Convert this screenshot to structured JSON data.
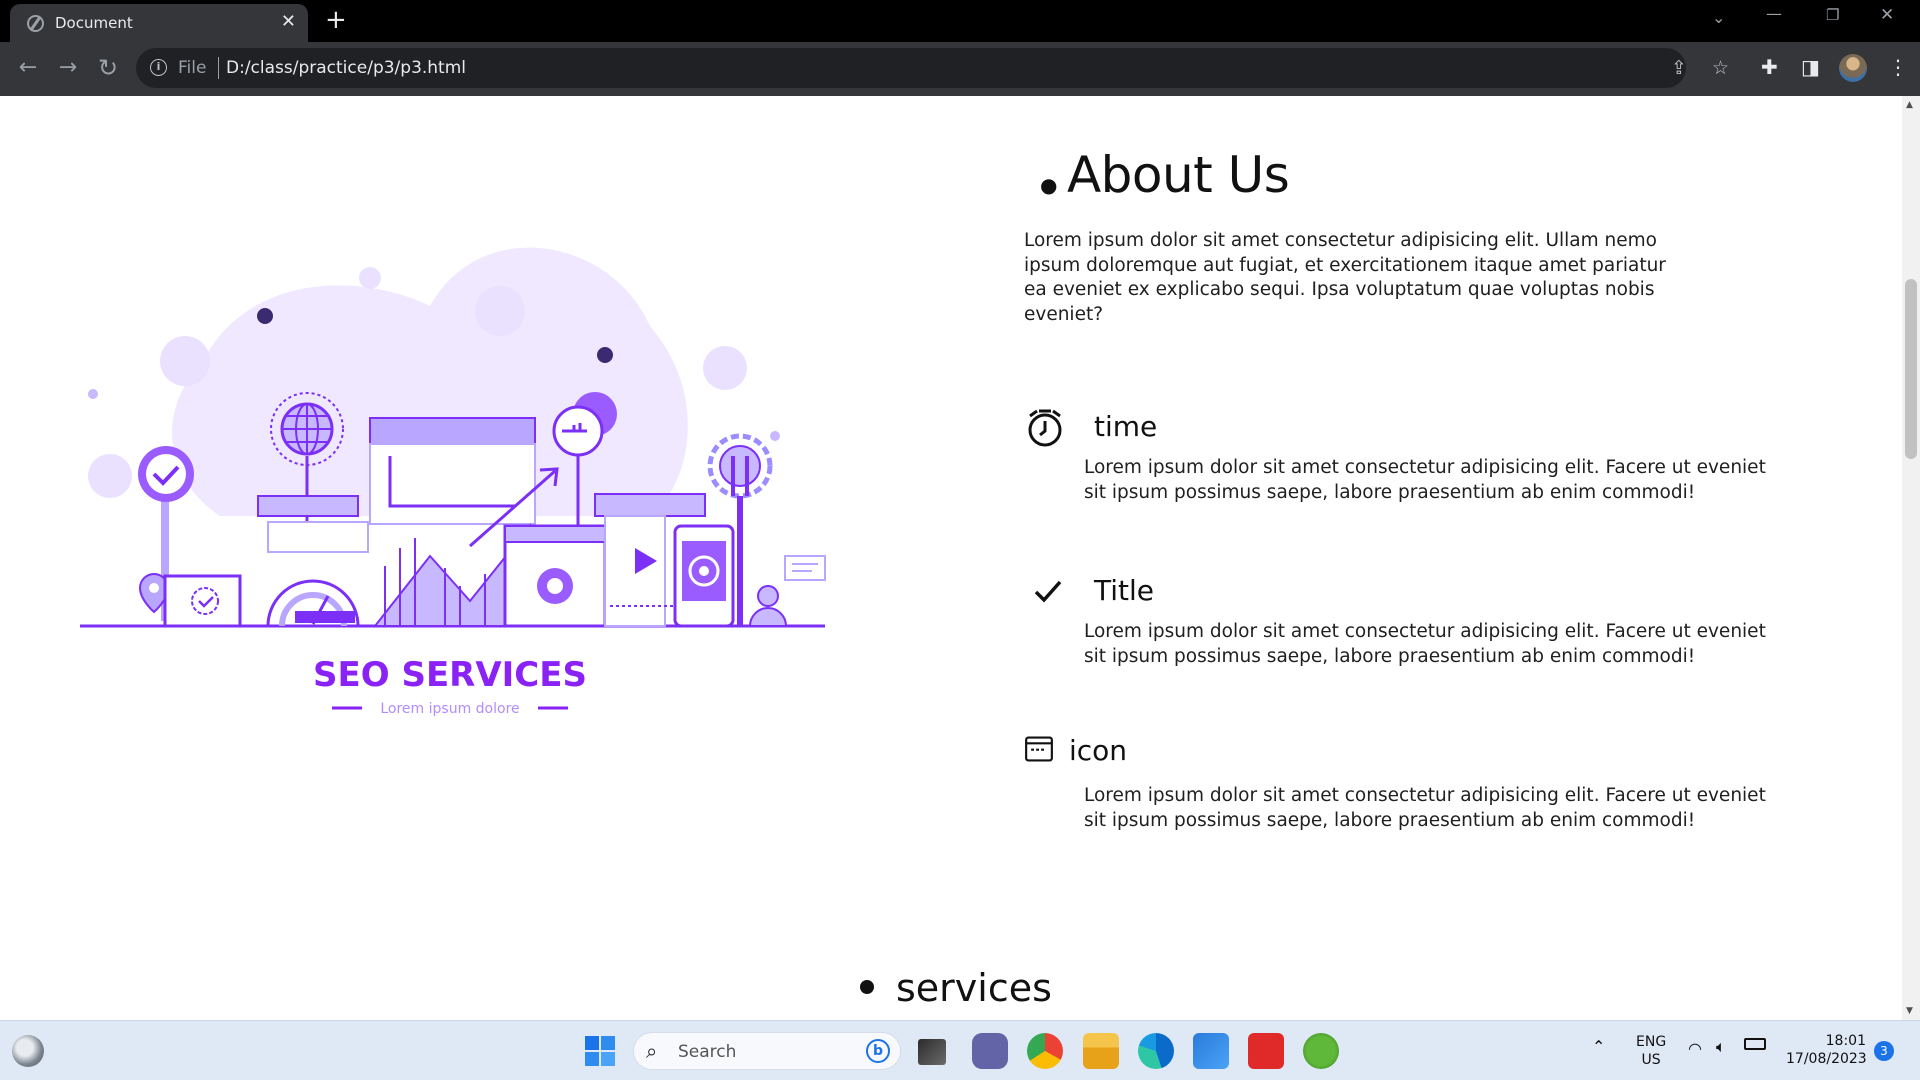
{
  "browser": {
    "tab_title": "Document",
    "url_scheme": "File",
    "url": "D:/class/practice/p3/p3.html"
  },
  "hero_image": {
    "headline": "SEO SERVICES",
    "tagline": "Lorem ipsum dolore"
  },
  "about": {
    "title": "About Us",
    "description": "Lorem ipsum dolor sit amet consectetur adipisicing elit. Ullam nemo ipsum doloremque aut fugiat, et exercitationem itaque amet pariatur ea eveniet ex explicabo sequi. Ipsa voluptatum quae voluptas nobis eveniet?"
  },
  "features": [
    {
      "icon": "alarm-clock-icon",
      "title": "time",
      "text": "Lorem ipsum dolor sit amet consectetur adipisicing elit. Facere ut eveniet sit ipsum possimus saepe, labore praesentium ab enim commodi!"
    },
    {
      "icon": "checkmark-icon",
      "title": "Title",
      "text": "Lorem ipsum dolor sit amet consectetur adipisicing elit. Facere ut eveniet sit ipsum possimus saepe, labore praesentium ab enim commodi!"
    },
    {
      "icon": "window-icon",
      "title": "icon",
      "text": "Lorem ipsum dolor sit amet consectetur adipisicing elit. Facere ut eveniet sit ipsum possimus saepe, labore praesentium ab enim commodi!"
    }
  ],
  "services": {
    "title": "services"
  },
  "taskbar": {
    "search_label": "Search",
    "language": "ENG",
    "region": "US",
    "time": "18:01",
    "date": "17/08/2023",
    "notification_count": "3"
  },
  "colors": {
    "accent": "#7b2ff7",
    "accent_light": "#b9a6ff",
    "chrome_dark": "#35363a"
  }
}
